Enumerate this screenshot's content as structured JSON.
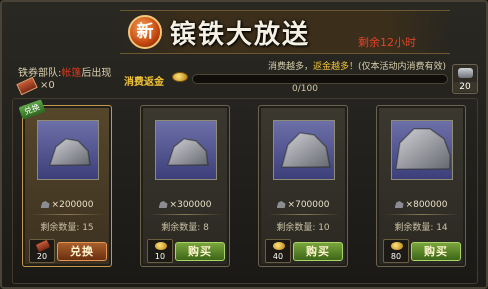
{
  "header": {
    "badge": "新",
    "title": "镔铁大放送",
    "remaining_time": "剩余12小时"
  },
  "left_info": {
    "prefix": "铁券部队:",
    "highlight": "帐篷",
    "suffix": "后出现",
    "scroll_count": "×0"
  },
  "spend": {
    "info_prefix": "消费越多，",
    "info_highlight": "返金越多！",
    "info_suffix": "(仅本活动内消费有效)",
    "label": "消费返金",
    "progress_text": "0/100",
    "progress_fraction": 0,
    "reward_count": "20"
  },
  "cards": [
    {
      "tag": "兑换",
      "amount": "×200000",
      "stock": "剩余数量: 15",
      "price": "20",
      "button": "兑换",
      "button_type": "exchange",
      "price_icon": "scroll-icon",
      "rock_size": "small"
    },
    {
      "tag": "",
      "amount": "×300000",
      "stock": "剩余数量: 8",
      "price": "10",
      "button": "购买",
      "button_type": "buy",
      "price_icon": "gold-icon",
      "rock_size": "small"
    },
    {
      "tag": "",
      "amount": "×700000",
      "stock": "剩余数量: 10",
      "price": "40",
      "button": "购买",
      "button_type": "buy",
      "price_icon": "gold-icon",
      "rock_size": "medium"
    },
    {
      "tag": "",
      "amount": "×800000",
      "stock": "剩余数量: 14",
      "price": "80",
      "button": "购买",
      "button_type": "buy",
      "price_icon": "gold-icon",
      "rock_size": "large"
    }
  ],
  "colors": {
    "accent_gold": "#f2c438",
    "alert_red": "#e0442a",
    "buy_green": "#5a8a2a",
    "exchange_brown": "#8a4a20"
  }
}
